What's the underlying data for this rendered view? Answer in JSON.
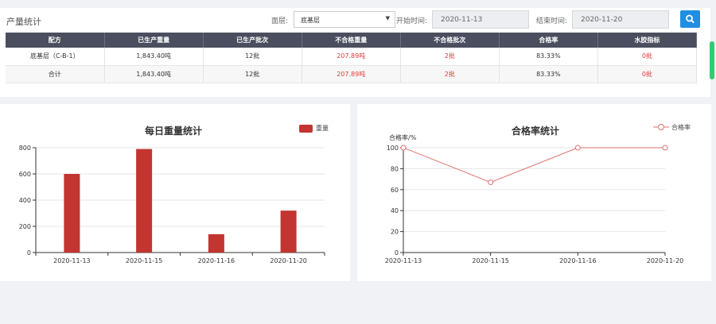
{
  "header": {
    "title": "产量统计",
    "layer_label": "面层:",
    "layer_value": "底基层",
    "start_label": "开始时间:",
    "start_value": "2020-11-13",
    "end_label": "结束时间:",
    "end_value": "2020-11-20"
  },
  "table": {
    "columns": [
      "配方",
      "已生产重量",
      "已生产批次",
      "不合格重量",
      "不合格批次",
      "合格率",
      "水胶指标"
    ],
    "rows": [
      [
        "底基层（C-B-1）",
        "1,843.40吨",
        "12批",
        "207.89吨",
        "2批",
        "83.33%",
        "0批"
      ],
      [
        "合计",
        "1,843.40吨",
        "12批",
        "207.89吨",
        "2批",
        "83.33%",
        "0批"
      ]
    ]
  },
  "colors": {
    "bar": "#c23531",
    "line": "#e07070",
    "header_bg": "#4b4e5e",
    "accent": "#1e8fe1",
    "alert": "#e83a3a"
  },
  "chart_data": [
    {
      "type": "bar",
      "title": "每日重量统计",
      "categories": [
        "2020-11-13",
        "2020-11-15",
        "2020-11-16",
        "2020-11-20"
      ],
      "series": [
        {
          "name": "重量",
          "values": [
            600,
            790,
            140,
            320
          ]
        }
      ],
      "ylim": [
        0,
        800
      ],
      "yticks": [
        0,
        200,
        400,
        600,
        800
      ],
      "xlabel": "",
      "ylabel": "",
      "grid": true,
      "legend": "top-right"
    },
    {
      "type": "line",
      "title": "合格率统计",
      "categories": [
        "2020-11-13",
        "2020-11-15",
        "2020-11-16",
        "2020-11-20"
      ],
      "series": [
        {
          "name": "合格率",
          "values": [
            100,
            67,
            100,
            100
          ]
        }
      ],
      "ylim": [
        0,
        100
      ],
      "yticks": [
        0,
        20,
        40,
        60,
        80,
        100
      ],
      "xlabel": "",
      "ylabel": "合格率/%",
      "grid": true,
      "legend": "top-right"
    }
  ]
}
